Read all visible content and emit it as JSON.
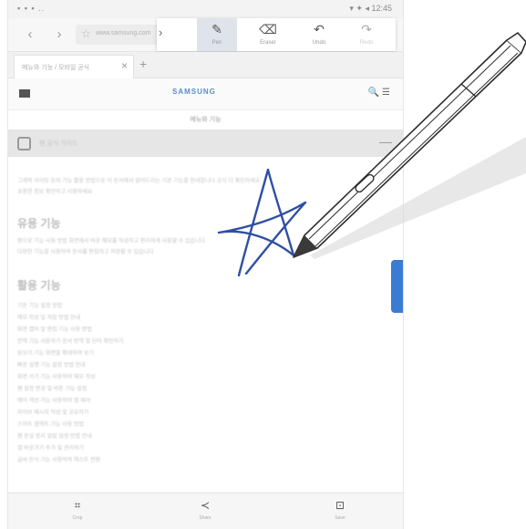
{
  "status": {
    "left": "▪ ▪ ▪ ..",
    "right": "▾ ✦ ◂ 12:45"
  },
  "toolbar": {
    "back_icon": "‹",
    "forward_icon": "›",
    "url_text": "www.samsung.com",
    "expand_icon": "›"
  },
  "pen_tools": [
    {
      "label": "Pen",
      "icon": "pen-icon",
      "glyph": "✎",
      "active": true
    },
    {
      "label": "Eraser",
      "icon": "eraser-icon",
      "glyph": "⌫",
      "active": false
    },
    {
      "label": "Undo",
      "icon": "undo-icon",
      "glyph": "↶",
      "active": false
    },
    {
      "label": "Redo",
      "icon": "redo-icon",
      "glyph": "↷",
      "active": false
    }
  ],
  "tab": {
    "title": "메뉴와 기능 / 모바일 공식",
    "close": "×",
    "add": "+"
  },
  "site": {
    "logo": "SAMSUNG",
    "icons": "🔍 ☰"
  },
  "page_subtitle": "메뉴와 기능",
  "section": {
    "title": "펜 공식 가이드",
    "collapse": "—"
  },
  "content": {
    "intro": [
      "그래픽 라이팅 등의 기능 활용 방법으로 이 문서에서 알려드리는 기본 기능을 안내합니다 공식 더 확인하세요",
      "유용한 정보 확인하고 사용하세요"
    ],
    "heading1": "유용 기능",
    "para1": [
      "펜으로 기능 사용 방법 화면에서 바로 메모를 작성하고 편리하게 사용할 수 있습니다",
      "다양한 기능을 사용하여 문서를 편집하고 저장할 수 있습니다"
    ],
    "heading2": "활용 기능",
    "items": [
      "기본 기능 설정 방법",
      "메모 작성 및 저장 방법 안내",
      "화면 캡처 및 편집 기능 사용 방법",
      "번역 기능 사용하기 문서 번역 및 단어 확인하기",
      "돋보기 기능 화면을 확대하여 보기",
      "빠른 실행 기능 설정 방법 안내",
      "화면 쓰기 기능 사용하여 메모 작성",
      "펜 설정 변경 및 버튼 기능 설정",
      "에어 액션 기능 사용하여 앱 제어",
      "라이브 메시지 작성 및 공유하기",
      "스마트 셀렉트 기능 사용 방법",
      "펜 분실 방지 알림 설정 방법 안내",
      "앱 바로가기 추가 및 관리하기",
      "글씨 인식 기능 사용하여 텍스트 변환"
    ]
  },
  "bottom_bar": [
    {
      "label": "Crop",
      "icon": "crop-icon",
      "glyph": "⌗"
    },
    {
      "label": "Share",
      "icon": "share-icon",
      "glyph": "≺"
    },
    {
      "label": "Save",
      "icon": "save-icon",
      "glyph": "⊡"
    }
  ],
  "colors": {
    "ink": "#2f4fa3",
    "side_tab": "#3b7bd3",
    "section_bar": "#e6e6e6"
  }
}
